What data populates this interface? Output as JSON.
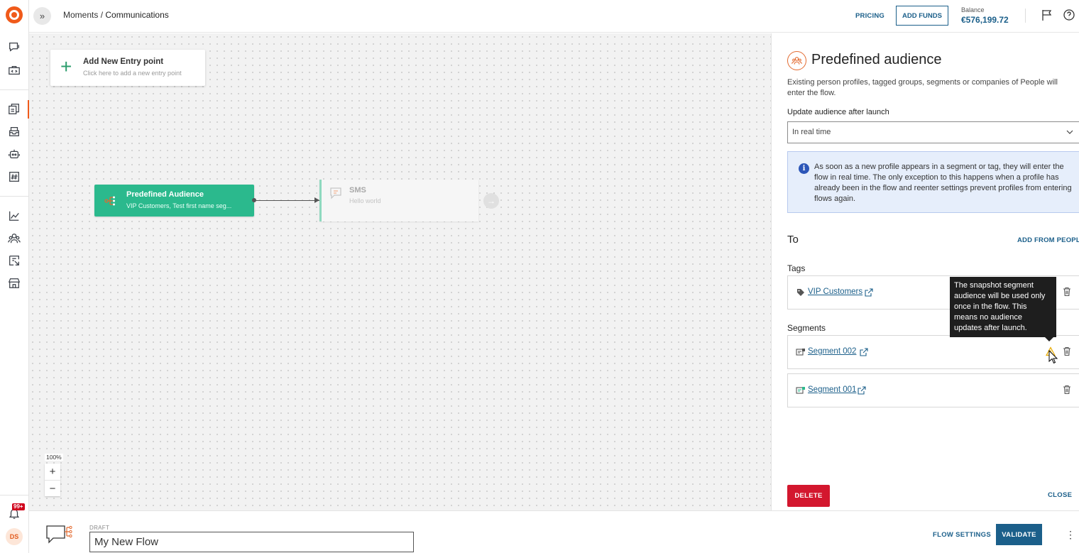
{
  "header": {
    "breadcrumb_parent": "Moments",
    "breadcrumb_separator": " / ",
    "breadcrumb_current": "Communications",
    "pricing_label": "PRICING",
    "add_funds_label": "ADD FUNDS",
    "balance_label": "Balance",
    "balance_value": "€576,199.72"
  },
  "rail": {
    "notification_badge": "99+",
    "avatar_initials": "DS"
  },
  "canvas": {
    "entry_title": "Add New Entry point",
    "entry_subtitle": "Click here to add a new entry point",
    "audience_node": {
      "title": "Predefined Audience",
      "subtitle": "VIP Customers, Test first name seg..."
    },
    "sms_node": {
      "title": "SMS",
      "subtitle": "Hello world"
    },
    "zoom_level": "100%",
    "zoom_in": "+",
    "zoom_out": "−"
  },
  "panel": {
    "title": "Predefined audience",
    "description": "Existing person profiles, tagged groups, segments or companies of People will enter the flow.",
    "update_label": "Update audience after launch",
    "update_value": "In real time",
    "info_text": "As soon as a new profile appears in a segment or tag, they will enter the flow in real time. The only exception to this happens when a profile has already been in the flow and reenter settings prevent profiles from entering flows again.",
    "to_title": "To",
    "add_from_people": "ADD FROM PEOPLE",
    "tags_label": "Tags",
    "tags": [
      {
        "name": "VIP Customers"
      }
    ],
    "segments_label": "Segments",
    "segments": [
      {
        "name": "Segment 002",
        "snapshot": true
      },
      {
        "name": "Segment 001",
        "snapshot": false
      }
    ],
    "tooltip": "The snapshot segment audience will be used only once in the flow. This means no audience updates after launch.",
    "delete_label": "DELETE",
    "close_label": "CLOSE"
  },
  "footer": {
    "draft_label": "DRAFT",
    "flow_name": "My New Flow",
    "flow_settings_label": "FLOW SETTINGS",
    "validate_label": "VALIDATE",
    "more_label": "⋮"
  },
  "colors": {
    "brand": "#f05a1a",
    "accent": "#1b5f8a",
    "node_green": "#2bb98d",
    "danger": "#d3172e",
    "info_bg": "#e6eefb"
  }
}
